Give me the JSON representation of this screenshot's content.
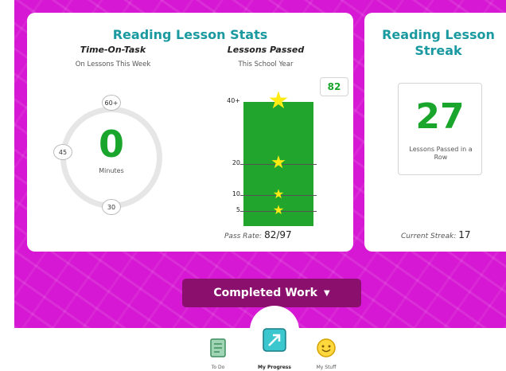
{
  "stats_card": {
    "title": "Reading Lesson Stats",
    "time_on_task": {
      "heading": "Time-On-Task",
      "caption": "On Lessons This Week",
      "value": "0",
      "unit": "Minutes",
      "markers": {
        "top": "60+",
        "left": "45",
        "bottom": "30"
      }
    },
    "lessons_passed": {
      "heading": "Lessons Passed",
      "caption": "This School Year",
      "count": "82",
      "ticks": [
        "40+",
        "20",
        "10",
        "5"
      ],
      "tick_values": [
        40,
        20,
        10,
        5
      ],
      "max": 40
    },
    "pass_rate": {
      "label": "Pass Rate:",
      "value": "82/97"
    }
  },
  "streak_card": {
    "title": "Reading Lesson Streak",
    "value": "27",
    "caption": "Lessons Passed in a Row",
    "current_label": "Current Streak:",
    "current_value": "17"
  },
  "completed_button": {
    "label": "Completed Work"
  },
  "nav": {
    "items": [
      {
        "label": "To Do",
        "icon": "todo-list-icon"
      },
      {
        "label": "My Progress",
        "icon": "progress-arrow-icon"
      },
      {
        "label": "My Stuff",
        "icon": "smiley-icon"
      }
    ]
  },
  "colors": {
    "background": "#d617d3",
    "title": "#1a9aa0",
    "green": "#22a52c",
    "star": "#ffeb14",
    "button": "#8b0f6d"
  }
}
